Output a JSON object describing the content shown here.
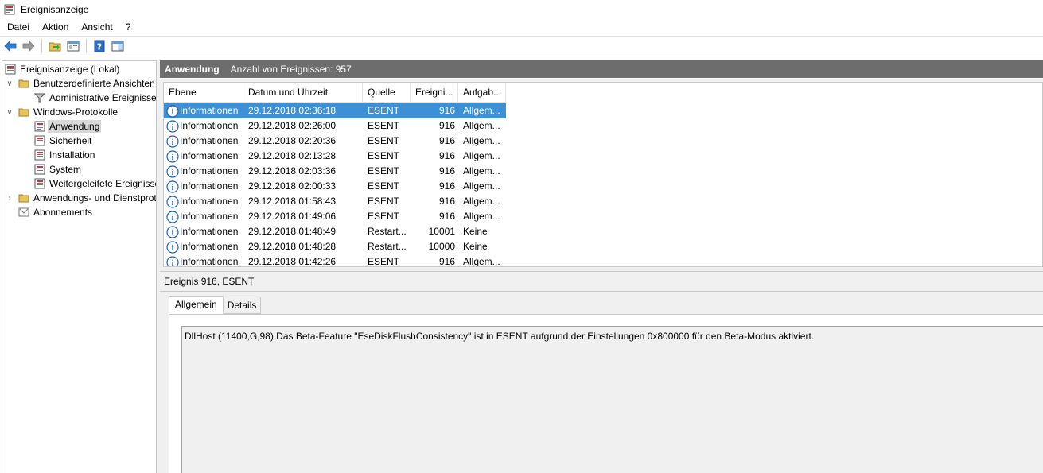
{
  "window": {
    "title": "Ereignisanzeige"
  },
  "menu": [
    "Datei",
    "Aktion",
    "Ansicht",
    "?"
  ],
  "toolbar": {
    "buttons": [
      "back-arrow-icon",
      "forward-arrow-icon",
      "open-folder-icon",
      "properties-icon",
      "help-icon",
      "show-panel-icon"
    ]
  },
  "tree": {
    "root": "Ereignisanzeige (Lokal)",
    "custom_views": "Benutzerdefinierte Ansichten",
    "admin_events": "Administrative Ereignisse",
    "windows_logs": "Windows-Protokolle",
    "application": "Anwendung",
    "security": "Sicherheit",
    "setup": "Installation",
    "system": "System",
    "forwarded": "Weitergeleitete Ereignisse",
    "app_service_logs": "Anwendungs- und Dienstprotokolle",
    "subscriptions": "Abonnements"
  },
  "panel": {
    "title": "Anwendung",
    "count_text": "Anzahl von Ereignissen: 957"
  },
  "grid": {
    "columns": [
      "Ebene",
      "Datum und Uhrzeit",
      "Quelle",
      "Ereigni...",
      "Aufgab..."
    ],
    "rows": [
      {
        "level": "Informationen",
        "date": "29.12.2018 02:36:18",
        "source": "ESENT",
        "id": "916",
        "task": "Allgem..."
      },
      {
        "level": "Informationen",
        "date": "29.12.2018 02:26:00",
        "source": "ESENT",
        "id": "916",
        "task": "Allgem..."
      },
      {
        "level": "Informationen",
        "date": "29.12.2018 02:20:36",
        "source": "ESENT",
        "id": "916",
        "task": "Allgem..."
      },
      {
        "level": "Informationen",
        "date": "29.12.2018 02:13:28",
        "source": "ESENT",
        "id": "916",
        "task": "Allgem..."
      },
      {
        "level": "Informationen",
        "date": "29.12.2018 02:03:36",
        "source": "ESENT",
        "id": "916",
        "task": "Allgem..."
      },
      {
        "level": "Informationen",
        "date": "29.12.2018 02:00:33",
        "source": "ESENT",
        "id": "916",
        "task": "Allgem..."
      },
      {
        "level": "Informationen",
        "date": "29.12.2018 01:58:43",
        "source": "ESENT",
        "id": "916",
        "task": "Allgem..."
      },
      {
        "level": "Informationen",
        "date": "29.12.2018 01:49:06",
        "source": "ESENT",
        "id": "916",
        "task": "Allgem..."
      },
      {
        "level": "Informationen",
        "date": "29.12.2018 01:48:49",
        "source": "Restart...",
        "id": "10001",
        "task": "Keine"
      },
      {
        "level": "Informationen",
        "date": "29.12.2018 01:48:28",
        "source": "Restart...",
        "id": "10000",
        "task": "Keine"
      },
      {
        "level": "Informationen",
        "date": "29.12.2018 01:42:26",
        "source": "ESENT",
        "id": "916",
        "task": "Allgem..."
      }
    ]
  },
  "detail": {
    "title": "Ereignis 916, ESENT",
    "tabs": [
      "Allgemein",
      "Details"
    ],
    "description": "DllHost (11400,G,98) Das Beta-Feature \"EseDiskFlushConsistency\" ist in ESENT aufgrund der Einstellungen 0x800000 für den Beta-Modus aktiviert."
  },
  "colors": {
    "header_bg": "#6d6d6d",
    "selection": "#3d8fd6",
    "tree_selection": "#d9d9d9",
    "info_icon": "#1f5fb4"
  }
}
